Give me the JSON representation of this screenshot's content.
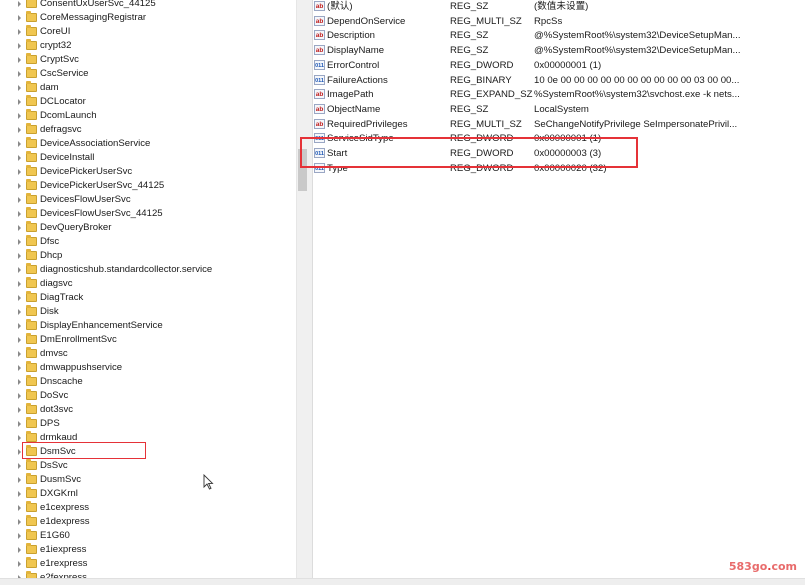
{
  "tree": {
    "items": [
      "ConsentUxUserSvc_44125",
      "CoreMessagingRegistrar",
      "CoreUI",
      "crypt32",
      "CryptSvc",
      "CscService",
      "dam",
      "DCLocator",
      "DcomLaunch",
      "defragsvc",
      "DeviceAssociationService",
      "DeviceInstall",
      "DevicePickerUserSvc",
      "DevicePickerUserSvc_44125",
      "DevicesFlowUserSvc",
      "DevicesFlowUserSvc_44125",
      "DevQueryBroker",
      "Dfsc",
      "Dhcp",
      "diagnosticshub.standardcollector.service",
      "diagsvc",
      "DiagTrack",
      "Disk",
      "DisplayEnhancementService",
      "DmEnrollmentSvc",
      "dmvsc",
      "dmwappushservice",
      "Dnscache",
      "DoSvc",
      "dot3svc",
      "DPS",
      "drmkaud",
      "DsmSvc",
      "DsSvc",
      "DusmSvc",
      "DXGKrnl",
      "e1cexpress",
      "e1dexpress",
      "E1G60",
      "e1iexpress",
      "e1rexpress",
      "e2fexpress"
    ],
    "selected": "DsmSvc"
  },
  "values": {
    "rows": [
      {
        "name": "(默认)",
        "type": "REG_SZ",
        "data": "(数值未设置)",
        "icon": "string-value-icon"
      },
      {
        "name": "DependOnService",
        "type": "REG_MULTI_SZ",
        "data": "RpcSs",
        "icon": "string-value-icon"
      },
      {
        "name": "Description",
        "type": "REG_SZ",
        "data": "@%SystemRoot%\\system32\\DeviceSetupMan...",
        "icon": "string-value-icon"
      },
      {
        "name": "DisplayName",
        "type": "REG_SZ",
        "data": "@%SystemRoot%\\system32\\DeviceSetupMan...",
        "icon": "string-value-icon"
      },
      {
        "name": "ErrorControl",
        "type": "REG_DWORD",
        "data": "0x00000001 (1)",
        "icon": "binary-value-icon"
      },
      {
        "name": "FailureActions",
        "type": "REG_BINARY",
        "data": "10 0e 00 00 00 00 00 00 00 00 00 00 03 00 00...",
        "icon": "binary-value-icon"
      },
      {
        "name": "ImagePath",
        "type": "REG_EXPAND_SZ",
        "data": "%SystemRoot%\\system32\\svchost.exe -k nets...",
        "icon": "string-value-icon"
      },
      {
        "name": "ObjectName",
        "type": "REG_SZ",
        "data": "LocalSystem",
        "icon": "string-value-icon"
      },
      {
        "name": "RequiredPrivileges",
        "type": "REG_MULTI_SZ",
        "data": "SeChangeNotifyPrivilege SeImpersonatePrivil...",
        "icon": "string-value-icon"
      },
      {
        "name": "ServiceSidType",
        "type": "REG_DWORD",
        "data": "0x00000001 (1)",
        "icon": "binary-value-icon"
      },
      {
        "name": "Start",
        "type": "REG_DWORD",
        "data": "0x00000003 (3)",
        "icon": "binary-value-icon"
      },
      {
        "name": "Type",
        "type": "REG_DWORD",
        "data": "0x00000020 (32)",
        "icon": "binary-value-icon"
      }
    ]
  },
  "watermark": {
    "prefix": "583go",
    "dot": ".",
    "suffix": "com"
  },
  "icons": {
    "string": "ab",
    "binary": "011"
  },
  "colors": {
    "highlight": "#e53238",
    "folder": "#f0c650"
  }
}
